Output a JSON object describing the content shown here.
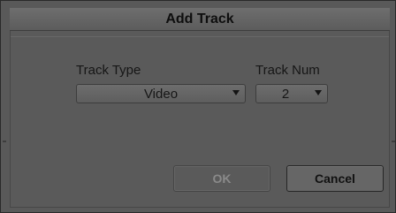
{
  "dialog": {
    "title": "Add Track"
  },
  "form": {
    "track_type_label": "Track Type",
    "track_type_value": "Video",
    "track_num_label": "Track Num",
    "track_num_value": "2"
  },
  "buttons": {
    "ok_label": "OK",
    "ok_enabled": false,
    "cancel_label": "Cancel"
  },
  "icons": {
    "dropdown": "chevron-down-icon"
  }
}
